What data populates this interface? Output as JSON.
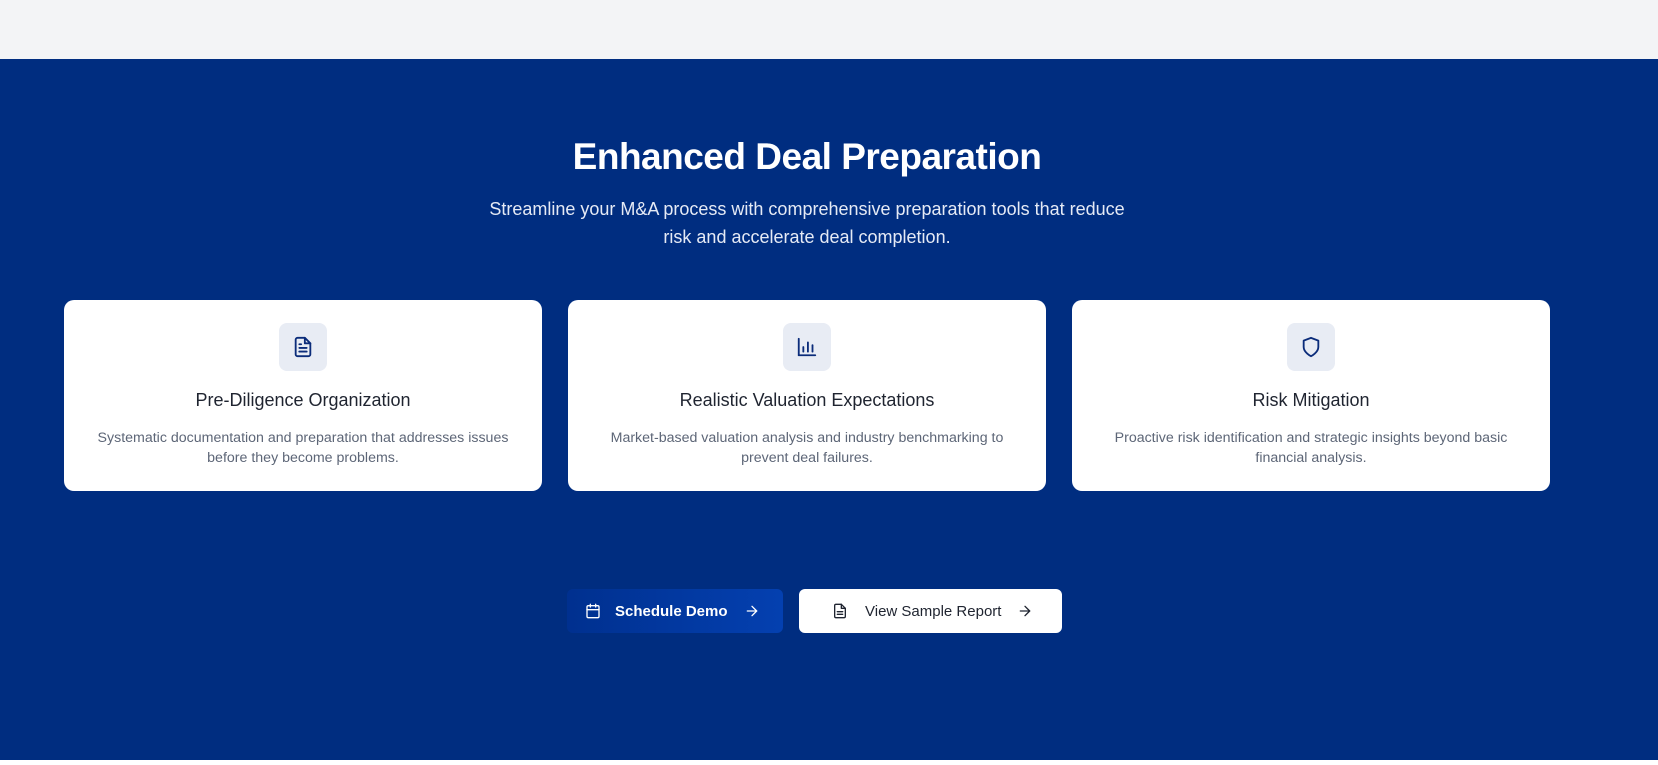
{
  "hero": {
    "title": "Enhanced Deal Preparation",
    "subtitle": "Streamline your M&A process with comprehensive preparation tools that reduce risk and accelerate deal completion."
  },
  "features": [
    {
      "icon": "document-icon",
      "title": "Pre-Diligence Organization",
      "description": "Systematic documentation and preparation that addresses issues before they become problems."
    },
    {
      "icon": "bar-chart-icon",
      "title": "Realistic Valuation Expectations",
      "description": "Market-based valuation analysis and industry benchmarking to prevent deal failures."
    },
    {
      "icon": "shield-icon",
      "title": "Risk Mitigation",
      "description": "Proactive risk identification and strategic insights beyond basic financial analysis."
    }
  ],
  "actions": {
    "schedule_demo": {
      "label": "Schedule Demo",
      "icon": "calendar-icon"
    },
    "view_report": {
      "label": "View Sample Report",
      "icon": "document-icon"
    }
  },
  "colors": {
    "hero_background": "#002d80",
    "top_strip": "#f3f4f6",
    "card_background": "#ffffff",
    "icon_box": "#e8ecf4",
    "accent": "#0440b0"
  }
}
